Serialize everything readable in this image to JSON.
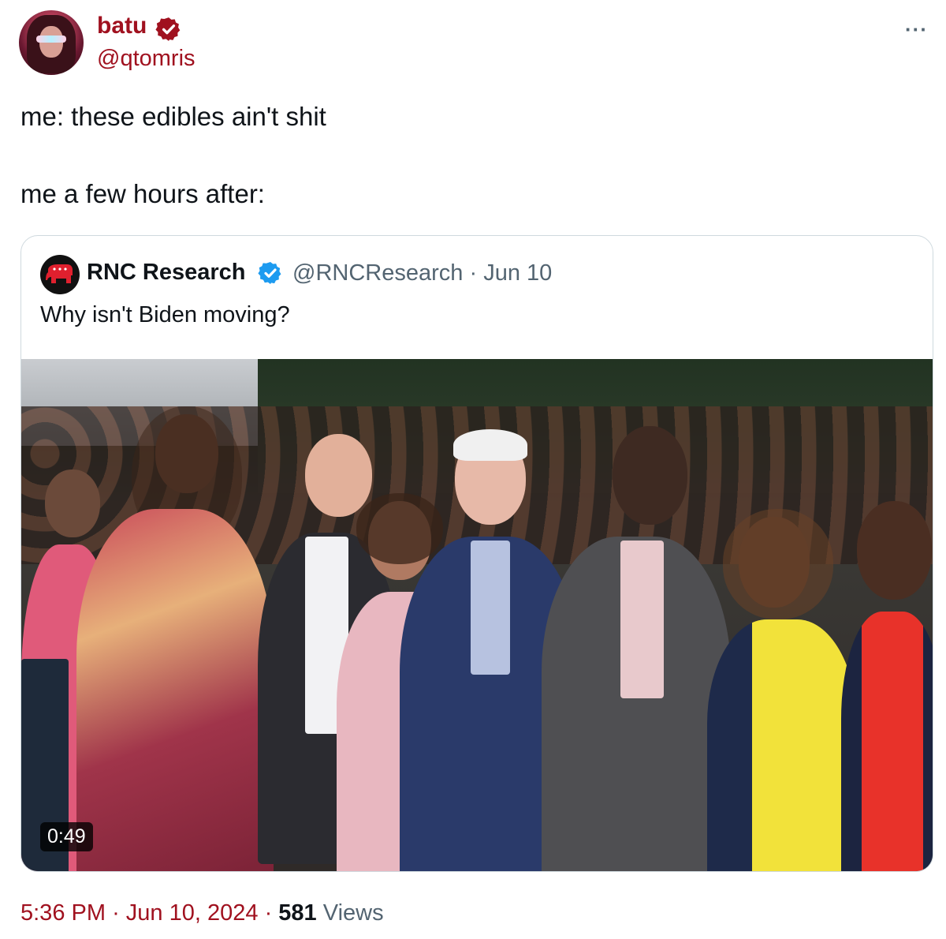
{
  "author": {
    "name": "batu",
    "handle": "@qtomris",
    "verified_badge_icon": "verified-badge-icon"
  },
  "tweet": {
    "lines": [
      "me: these edibles ain't shit",
      "me a few hours after:"
    ]
  },
  "quoted_tweet": {
    "name": "RNC Research",
    "handle": "@RNCResearch",
    "separator": "·",
    "date": "Jun 10",
    "text": "Why isn't Biden moving?",
    "video_duration": "0:49"
  },
  "footer": {
    "time": "5:36 PM",
    "separator": "·",
    "date": "Jun 10, 2024",
    "views_count": "581",
    "views_label": "Views"
  },
  "colors": {
    "accent": "#a0111f",
    "verified_blue": "#1d9bf0",
    "secondary_text": "#536471",
    "border": "#cfd9de"
  }
}
